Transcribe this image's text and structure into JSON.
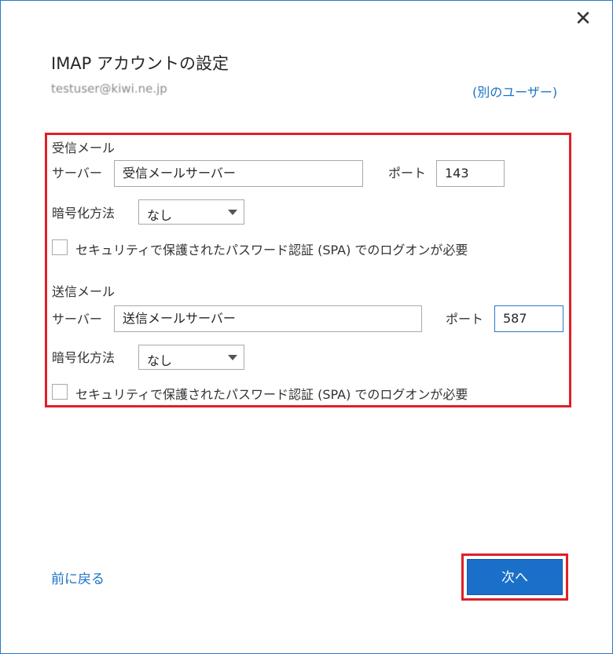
{
  "dialog": {
    "title": "IMAP アカウントの設定",
    "email": "testuser@kiwi.ne.jp",
    "other_user_link": "(別のユーザー)",
    "close_glyph": "✕"
  },
  "incoming": {
    "heading": "受信メール",
    "server_label": "サーバー",
    "server_value": "受信メールサーバー",
    "port_label": "ポート",
    "port_value": "143",
    "encryption_label": "暗号化方法",
    "encryption_value": "なし",
    "spa_label": "セキュリティで保護されたパスワード認証 (SPA) でのログオンが必要",
    "spa_checked": false
  },
  "outgoing": {
    "heading": "送信メール",
    "server_label": "サーバー",
    "server_value": "送信メールサーバー",
    "port_label": "ポート",
    "port_value": "587",
    "encryption_label": "暗号化方法",
    "encryption_value": "なし",
    "spa_label": "セキュリティで保護されたパスワード認証 (SPA) でのログオンが必要",
    "spa_checked": false
  },
  "footer": {
    "back_label": "前に戻る",
    "next_label": "次へ"
  },
  "colors": {
    "accent": "#1a6fc9",
    "link": "#1a73c7",
    "highlight": "#e01f2a",
    "window_border": "#2b78c9"
  }
}
